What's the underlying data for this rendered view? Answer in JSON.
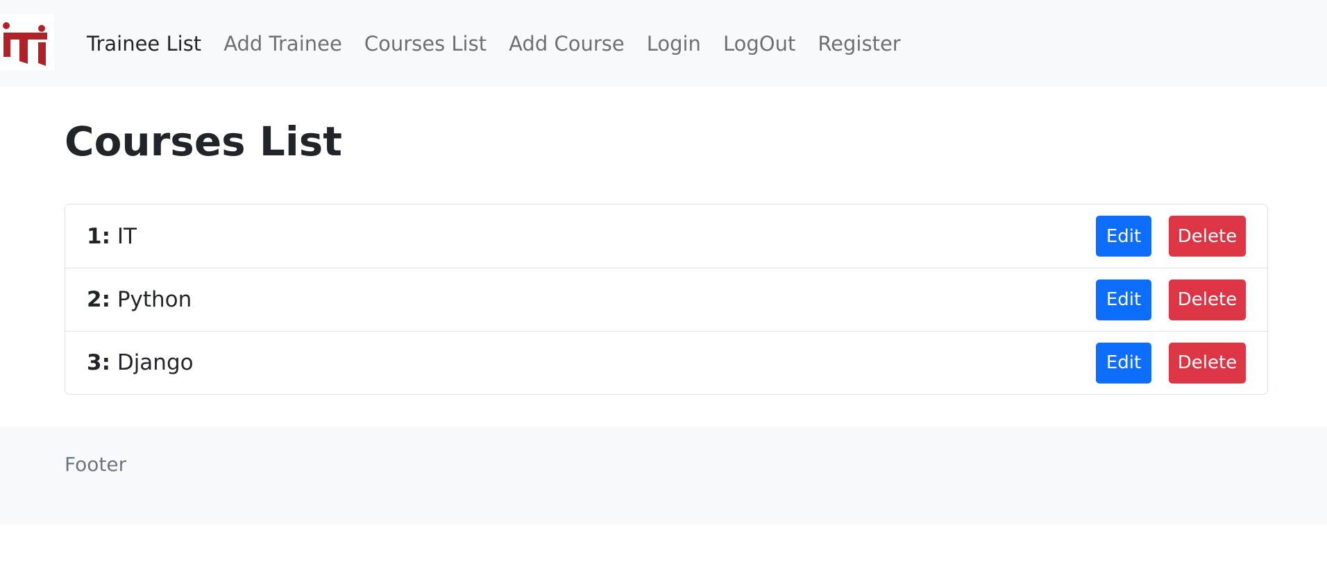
{
  "navbar": {
    "logo": {
      "text": "iTi",
      "icon": "iti-logo",
      "color": "#b22028"
    },
    "links": [
      {
        "label": "Trainee List",
        "active": true
      },
      {
        "label": "Add Trainee",
        "active": false
      },
      {
        "label": "Courses List",
        "active": false
      },
      {
        "label": "Add Course",
        "active": false
      },
      {
        "label": "Login",
        "active": false
      },
      {
        "label": "LogOut",
        "active": false
      },
      {
        "label": "Register",
        "active": false
      }
    ]
  },
  "main": {
    "title": "Courses List",
    "courses": [
      {
        "num": "1:",
        "name": "IT",
        "edit_label": "Edit",
        "delete_label": "Delete"
      },
      {
        "num": "2:",
        "name": "Python",
        "edit_label": "Edit",
        "delete_label": "Delete"
      },
      {
        "num": "3:",
        "name": "Django",
        "edit_label": "Edit",
        "delete_label": "Delete"
      }
    ]
  },
  "footer": {
    "text": "Footer"
  },
  "colors": {
    "edit_button": "#0d6efd",
    "delete_button": "#dc3545",
    "navbar_bg": "#f8f9fa"
  }
}
